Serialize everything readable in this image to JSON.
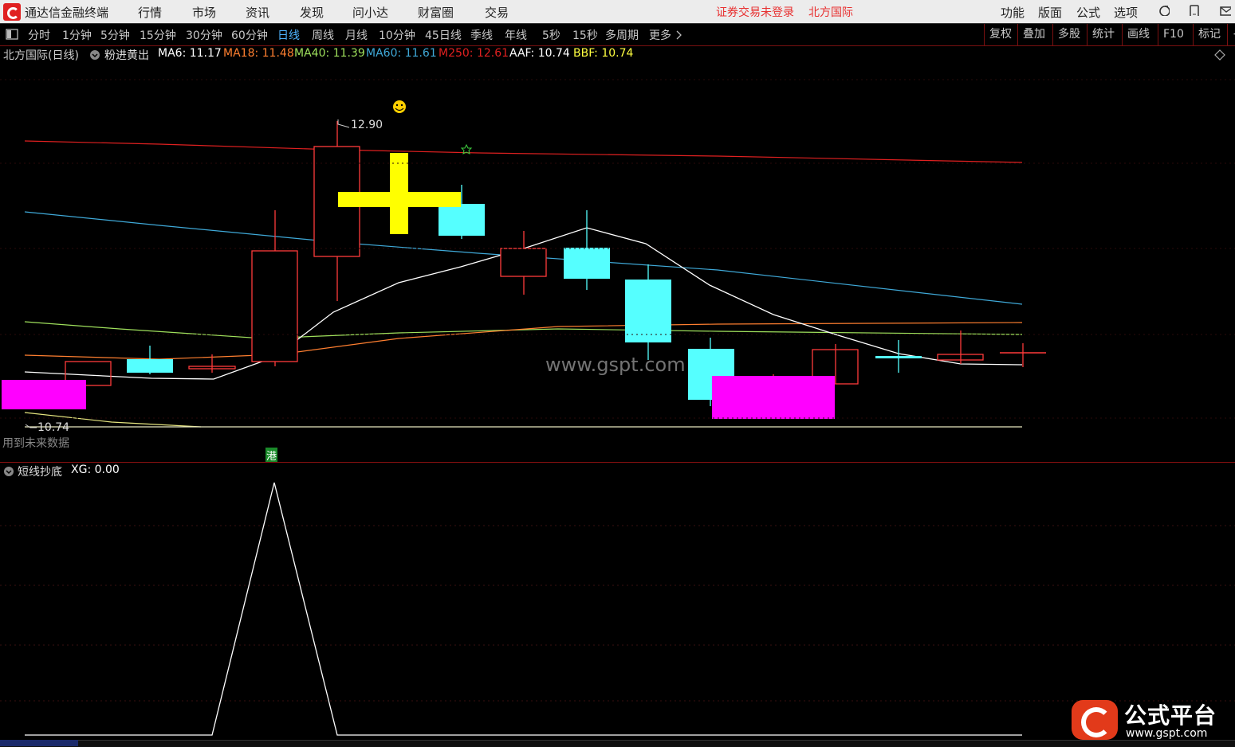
{
  "titlebar": {
    "app_title": "通达信金融终端",
    "menus": [
      "行情",
      "市场",
      "资讯",
      "发现",
      "问小达",
      "财富圈",
      "交易"
    ],
    "warning": "证券交易未登录",
    "stock_name": "北方国际",
    "right_menus": [
      "功能",
      "版面",
      "公式",
      "选项"
    ]
  },
  "periods": {
    "items": [
      "分时",
      "1分钟",
      "5分钟",
      "15分钟",
      "30分钟",
      "60分钟",
      "日线",
      "周线",
      "月线",
      "10分钟",
      "45日线",
      "季线",
      "年线",
      "5秒",
      "15秒",
      "多周期",
      "更多"
    ],
    "active": "日线",
    "right_tools": [
      "复权",
      "叠加",
      "多股",
      "统计",
      "画线",
      "F10",
      "标记"
    ]
  },
  "main_info": {
    "title": "北方国际(日线)",
    "indicator": "粉进黄出",
    "ma6_label": "MA6:",
    "ma6": "11.17",
    "ma18_label": "MA18:",
    "ma18": "11.48",
    "ma40_label": "MA40:",
    "ma40": "11.39",
    "ma60_label": "MA60:",
    "ma60": "11.61",
    "m250_label": "M250:",
    "m250": "12.61",
    "aaf_label": "AAF:",
    "aaf": "10.74",
    "bbf_label": "BBF:",
    "bbf": "10.74",
    "high_label": "12.90",
    "low_label": "10.74",
    "future_note": "用到未来数据",
    "hk_tag": "港"
  },
  "sub_info": {
    "indicator": "短线抄底",
    "xg_label": "XG:",
    "xg": "0.00"
  },
  "watermarks": {
    "center": "www.gspt.com",
    "logo_title": "公式平台",
    "logo_url": "www.gspt.com"
  },
  "colors": {
    "up": "#ff3b3b",
    "down": "#55ffff",
    "ma6": "#ffffff",
    "ma18": "#ff7f30",
    "ma40": "#9fe05c",
    "ma60": "#3fa9d8",
    "m250": "#e02020",
    "pink": "#ff00ff",
    "yellow": "#ffff00"
  }
}
